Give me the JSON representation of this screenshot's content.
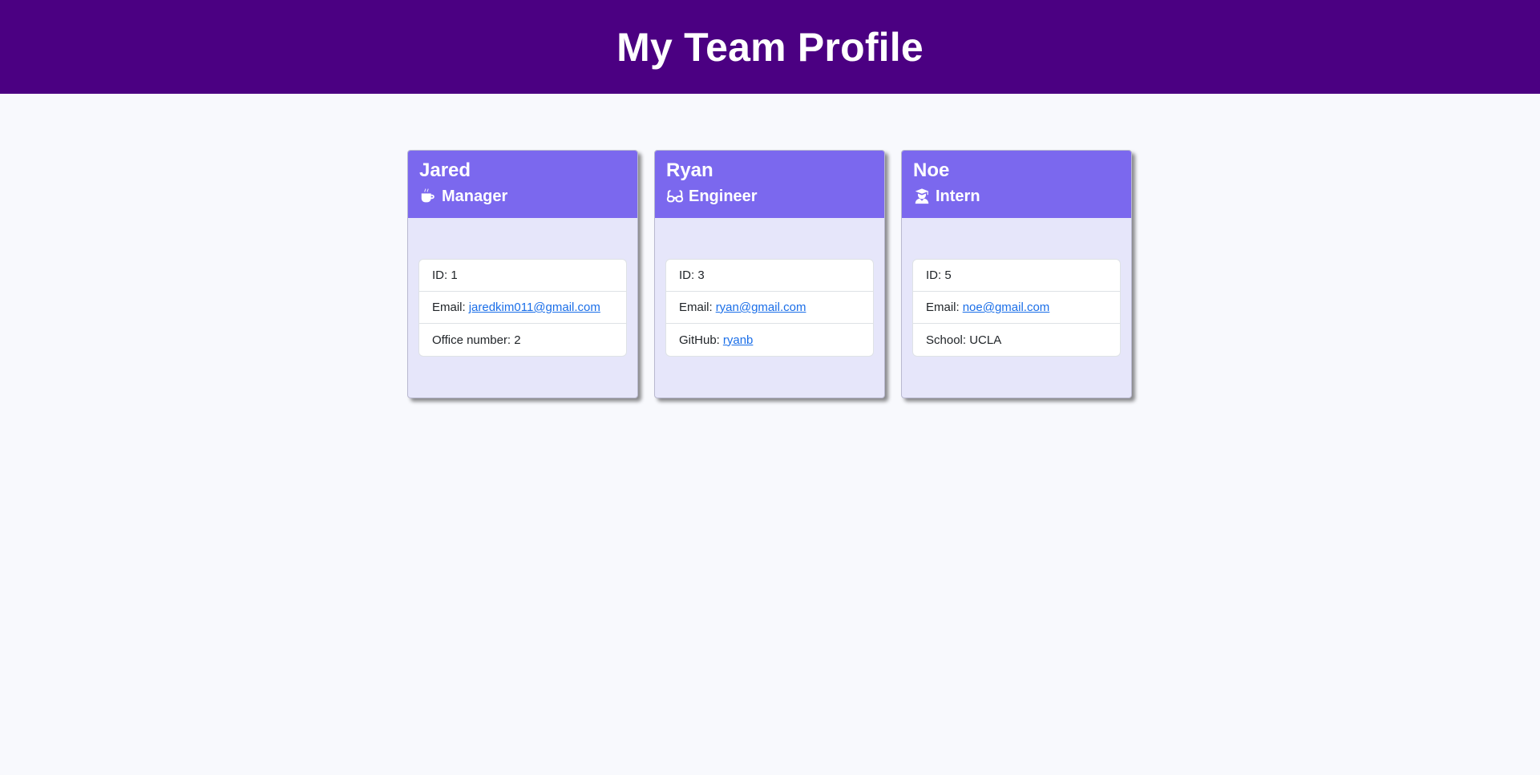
{
  "header": {
    "title": "My Team Profile",
    "background": "#4b0082"
  },
  "colors": {
    "card_header": "#7b68ee",
    "card_body": "#e6e6fa",
    "link": "#1a6ee8"
  },
  "team": [
    {
      "name": "Jared",
      "role": "Manager",
      "role_icon": "mug-hot-icon",
      "id_label": "ID: 1",
      "email_label": "Email:",
      "email": "jaredkim011@gmail.com",
      "extra_label": "Office number: 2"
    },
    {
      "name": "Ryan",
      "role": "Engineer",
      "role_icon": "glasses-icon",
      "id_label": "ID: 3",
      "email_label": "Email:",
      "email": "ryan@gmail.com",
      "extra_label": "GitHub:",
      "extra_link": "ryanb"
    },
    {
      "name": "Noe",
      "role": "Intern",
      "role_icon": "user-graduate-icon",
      "id_label": "ID: 5",
      "email_label": "Email:",
      "email": "noe@gmail.com",
      "extra_label": "School: UCLA"
    }
  ]
}
